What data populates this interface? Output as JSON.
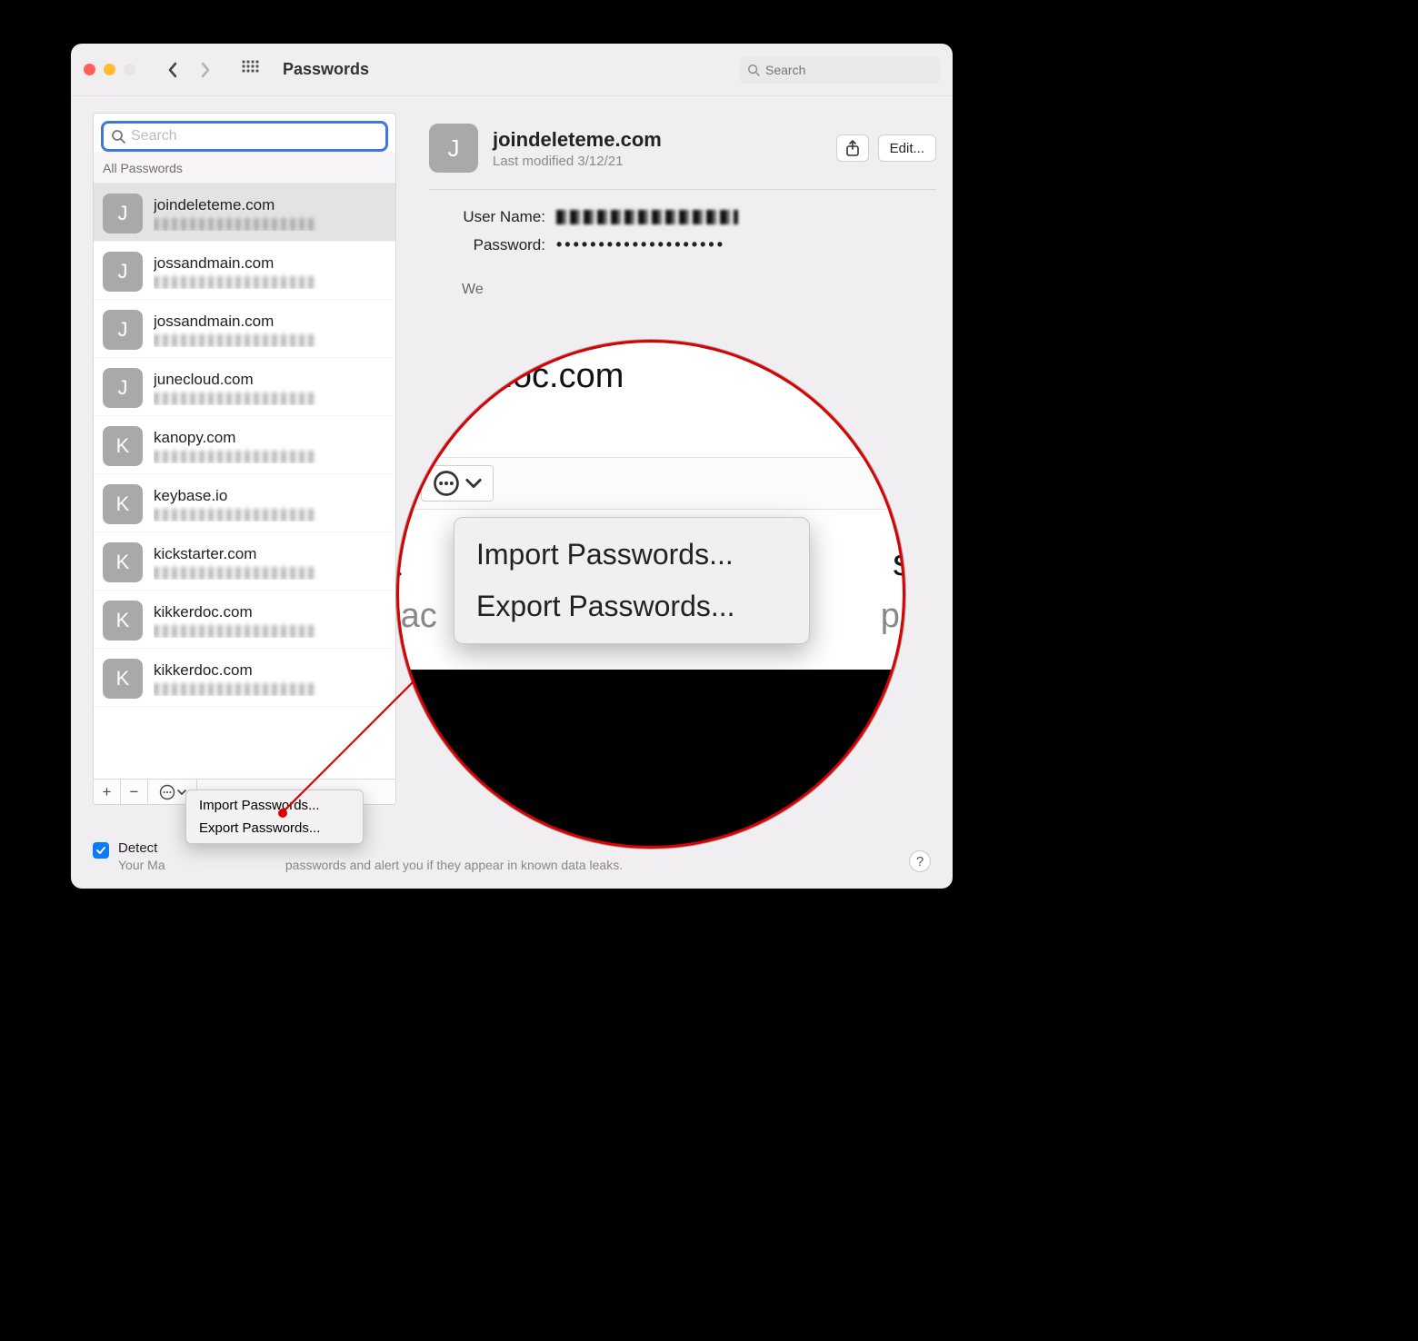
{
  "window": {
    "title": "Passwords",
    "search_placeholder": "Search"
  },
  "sidebar": {
    "search_placeholder": "Search",
    "category_label": "All Passwords",
    "add_icon": "+",
    "remove_icon": "−",
    "items": [
      {
        "letter": "J",
        "site": "joindeleteme.com",
        "selected": true
      },
      {
        "letter": "J",
        "site": "jossandmain.com"
      },
      {
        "letter": "J",
        "site": "jossandmain.com"
      },
      {
        "letter": "J",
        "site": "junecloud.com"
      },
      {
        "letter": "K",
        "site": "kanopy.com"
      },
      {
        "letter": "K",
        "site": "keybase.io"
      },
      {
        "letter": "K",
        "site": "kickstarter.com"
      },
      {
        "letter": "K",
        "site": "kikkerdoc.com"
      },
      {
        "letter": "K",
        "site": "kikkerdoc.com"
      }
    ]
  },
  "detail": {
    "letter": "J",
    "title": "joindeleteme.com",
    "subtitle": "Last modified 3/12/21",
    "edit_label": "Edit...",
    "username_label": "User Name:",
    "password_label": "Password:",
    "password_mask": "••••••••••••••••••••",
    "website_label": "We"
  },
  "popup_small": {
    "import": "Import Passwords...",
    "export": "Export Passwords..."
  },
  "magnifier": {
    "top_fragment": "erdoc.com",
    "import": "Import Passwords...",
    "export": "Export Passwords...",
    "left_frag1": "ct",
    "right_frag1": "s",
    "left_frag2": "Mac",
    "right_frag2": "pa"
  },
  "footer": {
    "checkbox_label": "Detect",
    "subtext_fragment": "passwords and alert you if they appear in known data leaks.",
    "subtext_prefix": "Your Ma",
    "help": "?"
  }
}
